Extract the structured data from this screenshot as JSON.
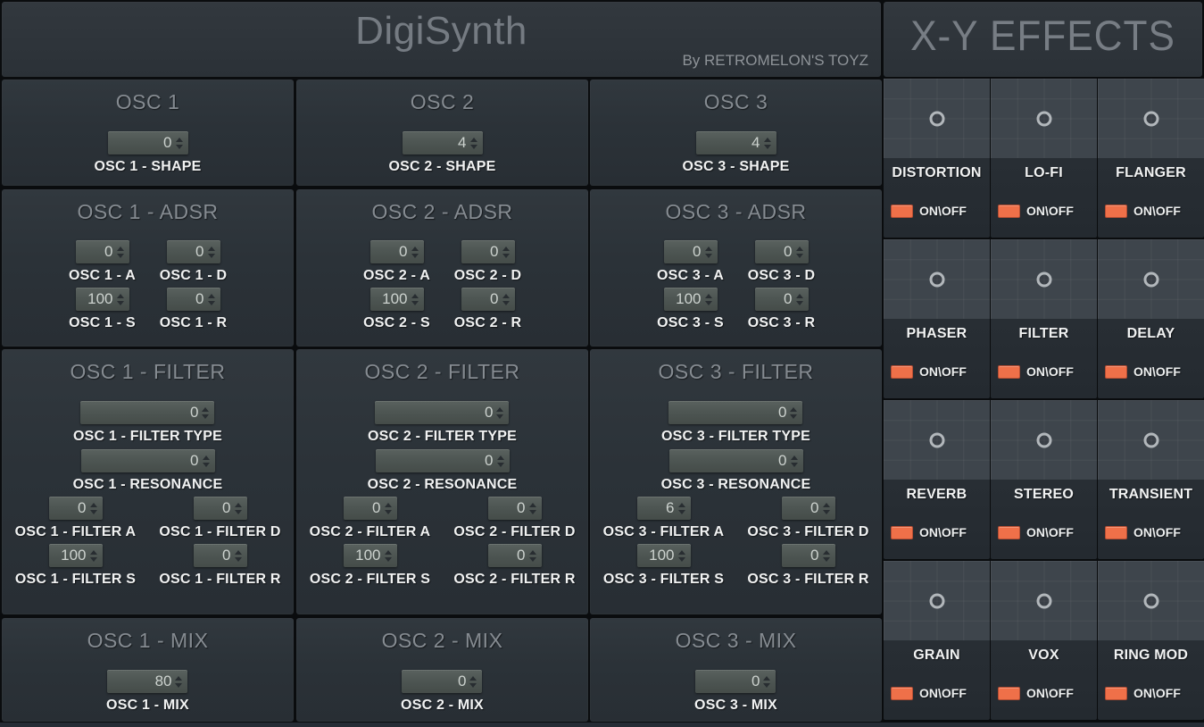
{
  "app": {
    "title": "DigiSynth",
    "byline": "By RETROMELON'S TOYZ"
  },
  "colors": {
    "panel_bg": "#2b3238",
    "pad_bg": "#3e454c",
    "accent_orange": "#ef7049",
    "title_gray": "#858b91",
    "label_white": "#f1f2f2"
  },
  "oscillators": [
    {
      "title": "OSC 1",
      "shape": {
        "value": "0",
        "label": "OSC 1 - SHAPE"
      },
      "adsr": {
        "title": "OSC 1 - ADSR",
        "a": {
          "value": "0",
          "label": "OSC 1 - A"
        },
        "d": {
          "value": "0",
          "label": "OSC 1 - D"
        },
        "s": {
          "value": "100",
          "label": "OSC 1 - S"
        },
        "r": {
          "value": "0",
          "label": "OSC 1 - R"
        }
      },
      "filter": {
        "title": "OSC 1 - FILTER",
        "type": {
          "value": "0",
          "label": "OSC 1 - FILTER TYPE"
        },
        "resonance": {
          "value": "0",
          "label": "OSC 1 - RESONANCE"
        },
        "a": {
          "value": "0",
          "label": "OSC 1 - FILTER A"
        },
        "d": {
          "value": "0",
          "label": "OSC 1 - FILTER D"
        },
        "s": {
          "value": "100",
          "label": "OSC 1 - FILTER S"
        },
        "r": {
          "value": "0",
          "label": "OSC 1 - FILTER R"
        }
      },
      "mix": {
        "title": "OSC 1 - MIX",
        "value": "80",
        "label": "OSC 1 - MIX"
      }
    },
    {
      "title": "OSC 2",
      "shape": {
        "value": "4",
        "label": "OSC 2 - SHAPE"
      },
      "adsr": {
        "title": "OSC 2 - ADSR",
        "a": {
          "value": "0",
          "label": "OSC 2 - A"
        },
        "d": {
          "value": "0",
          "label": "OSC 2 - D"
        },
        "s": {
          "value": "100",
          "label": "OSC 2 - S"
        },
        "r": {
          "value": "0",
          "label": "OSC 2 - R"
        }
      },
      "filter": {
        "title": "OSC 2 - FILTER",
        "type": {
          "value": "0",
          "label": "OSC 2 - FILTER TYPE"
        },
        "resonance": {
          "value": "0",
          "label": "OSC 2 - RESONANCE"
        },
        "a": {
          "value": "0",
          "label": "OSC 2 - FILTER A"
        },
        "d": {
          "value": "0",
          "label": "OSC 2 - FILTER D"
        },
        "s": {
          "value": "100",
          "label": "OSC 2 - FILTER S"
        },
        "r": {
          "value": "0",
          "label": "OSC 2 - FILTER R"
        }
      },
      "mix": {
        "title": "OSC 2 - MIX",
        "value": "0",
        "label": "OSC 2 - MIX"
      }
    },
    {
      "title": "OSC 3",
      "shape": {
        "value": "4",
        "label": "OSC 3 - SHAPE"
      },
      "adsr": {
        "title": "OSC 3 - ADSR",
        "a": {
          "value": "0",
          "label": "OSC 3 - A"
        },
        "d": {
          "value": "0",
          "label": "OSC 3 - D"
        },
        "s": {
          "value": "100",
          "label": "OSC 3 - S"
        },
        "r": {
          "value": "0",
          "label": "OSC 3 - R"
        }
      },
      "filter": {
        "title": "OSC 3 - FILTER",
        "type": {
          "value": "0",
          "label": "OSC 3 - FILTER TYPE"
        },
        "resonance": {
          "value": "0",
          "label": "OSC 3 - RESONANCE"
        },
        "a": {
          "value": "6",
          "label": "OSC 3 - FILTER A"
        },
        "d": {
          "value": "0",
          "label": "OSC 3 - FILTER D"
        },
        "s": {
          "value": "100",
          "label": "OSC 3 - FILTER S"
        },
        "r": {
          "value": "0",
          "label": "OSC 3 - FILTER R"
        }
      },
      "mix": {
        "title": "OSC 3 - MIX",
        "value": "0",
        "label": "OSC 3 - MIX"
      }
    }
  ],
  "effects": {
    "title": "X-Y EFFECTS",
    "toggle_label": "ON\\OFF",
    "cells": [
      {
        "name": "DISTORTION"
      },
      {
        "name": "LO-FI"
      },
      {
        "name": "FLANGER"
      },
      {
        "name": "PHASER"
      },
      {
        "name": "FILTER"
      },
      {
        "name": "DELAY"
      },
      {
        "name": "REVERB"
      },
      {
        "name": "STEREO"
      },
      {
        "name": "TRANSIENT"
      },
      {
        "name": "GRAIN"
      },
      {
        "name": "VOX"
      },
      {
        "name": "RING MOD"
      }
    ]
  }
}
